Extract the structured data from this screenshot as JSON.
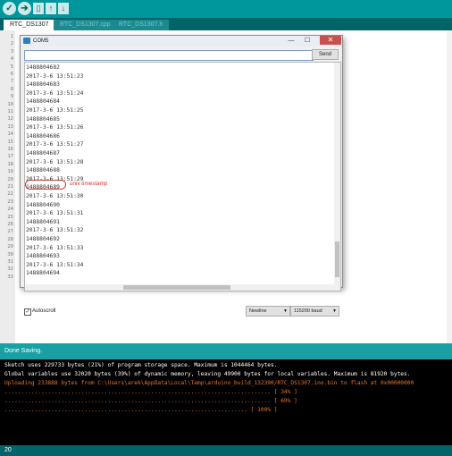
{
  "tabs": [
    "RTC_DS1307",
    "RTC_DS1307.cpp",
    "RTC_DS1307.h"
  ],
  "line_numbers": [
    "1",
    "2",
    "3",
    "4",
    "5",
    "6",
    "7",
    "8",
    "9",
    "10",
    "11",
    "12",
    "13",
    "14",
    "15",
    "16",
    "17",
    "18",
    "19",
    "20",
    "21",
    "22",
    "23",
    "24",
    "25",
    "26",
    "27",
    "28",
    "29",
    "30",
    "31",
    "32",
    "33"
  ],
  "serial_window": {
    "title": "COM5",
    "close_glyph": "✕",
    "minimize_glyph": "—",
    "maximize_glyph": "☐",
    "input_value": "",
    "send_label": "Send",
    "lines": [
      "1488804682",
      "2017-3-6 13:51:23",
      "1488804683",
      "2017-3-6 13:51:24",
      "1488804684",
      "2017-3-6 13:51:25",
      "1488804685",
      "2017-3-6 13:51:26",
      "1488804686",
      "2017-3-6 13:51:27",
      "1488804687",
      "2017-3-6 13:51:28",
      "1488804688",
      "2017-3-6 13:51:29",
      "1488804689",
      "2017-3-6 13:51:30",
      "1488804690",
      "2017-3-6 13:51:31",
      "1488804691",
      "2017-3-6 13:51:32",
      "1488804692",
      "2017-3-6 13:51:33",
      "1488804693",
      "2017-3-6 13:51:34",
      "1488804694"
    ],
    "annotation": "unix timestamp",
    "autoscroll_label": "Autoscroll",
    "autoscroll_checked": "✓",
    "line_ending": "Newline",
    "baud": "115200 baud"
  },
  "status": {
    "text": "Done Saving."
  },
  "console": {
    "lines": [
      {
        "text": "Sketch uses 229733 bytes (21%) of program storage space. Maximum is 1044464 bytes.",
        "color": "white"
      },
      {
        "text": "Global variables use 32020 bytes (39%) of dynamic memory, leaving 49900 bytes for local variables. Maximum is 81920 bytes.",
        "color": "white"
      },
      {
        "text": "Uploading 233888 bytes from C:\\Users\\arek\\AppData\\Local\\Temp\\arduino_build_132390/RTC_DS1307.ino.bin to flash at 0x00000000",
        "color": "orange"
      },
      {
        "text": "................................................................................ [ 34% ]",
        "color": "orange"
      },
      {
        "text": "................................................................................ [ 69% ]",
        "color": "orange"
      },
      {
        "text": "......................................................................... [ 100% ]",
        "color": "orange"
      }
    ]
  },
  "footer": {
    "line": "20"
  },
  "colors": {
    "teal": "#00979c",
    "dark_teal": "#006468",
    "status": "#17a1a5",
    "annotation": "#e03030",
    "console_orange": "#e8762d"
  },
  "icons": [
    "verify-icon",
    "upload-icon",
    "new-icon",
    "open-icon",
    "save-icon"
  ]
}
